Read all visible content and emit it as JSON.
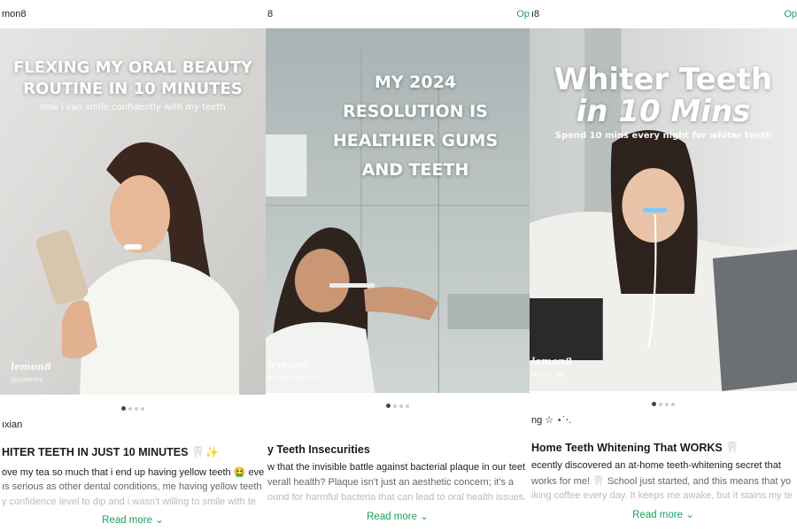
{
  "colors": {
    "accent": "#1aa260"
  },
  "read_more_icon": "chevron-down-icon",
  "posts": [
    {
      "author_tab": "mon8",
      "overlay_title_1": "FLEXING MY ORAL BEAUTY",
      "overlay_title_2": "ROUTINE IN 10 MINUTES",
      "overlay_sub": "now i can smile confidently with my teeth",
      "watermark": "lemon8",
      "handle": "@jiaxianlee",
      "carousel": {
        "total": 4,
        "active": 1
      },
      "username": "ıxian",
      "title": "HITER TEETH IN JUST 10 MINUTES 🦷✨",
      "lines": [
        "ove my tea so much that i end up having yellow teeth 🤮 eve",
        "ıs serious as other dental conditions, me having yellow teeth",
        "y confidence level to dip and i wasn't willing to smile with te"
      ],
      "read_more": "Read more"
    },
    {
      "author_tab": "8",
      "overlay_title_lines": [
        "MY 2024",
        "RESOLUTION IS",
        "HEALTHIER GUMS",
        "AND TEETH"
      ],
      "watermark": "lemon8",
      "handle": "@natashatanonnn",
      "carousel": {
        "total": 4,
        "active": 1
      },
      "title": "y Teeth Insecurities",
      "lines": [
        "w that the invisible battle against bacterial plaque in our teet",
        "verall health? Plaque isn't just an aesthetic concern; it's a",
        "ound for harmful bacteria that can lead to oral health issues."
      ],
      "read_more": "Read more"
    },
    {
      "author_tab": "Op",
      "open_label": "Op",
      "author_tab_right": "ı8",
      "overlay_title_1": "Whiter Teeth",
      "overlay_title_2": "in 10 Mins",
      "overlay_sub": "Spend 10 mins every night for whiter teeth",
      "watermark": "lemon8",
      "handle": "@joyce_ngc",
      "carousel": {
        "total": 4,
        "active": 1
      },
      "username": "ng ☆ ⋆˙⋅.",
      "title": "Home Teeth Whitening That WORKS 🦷",
      "lines": [
        "ecently discovered an at-home teeth-whitening secret that",
        "works for me! 🦷 School just started, and this means that yo",
        "iking coffee every day. It keeps me awake, but it stains my te"
      ],
      "read_more": "Read more",
      "far_right": "Op"
    }
  ]
}
